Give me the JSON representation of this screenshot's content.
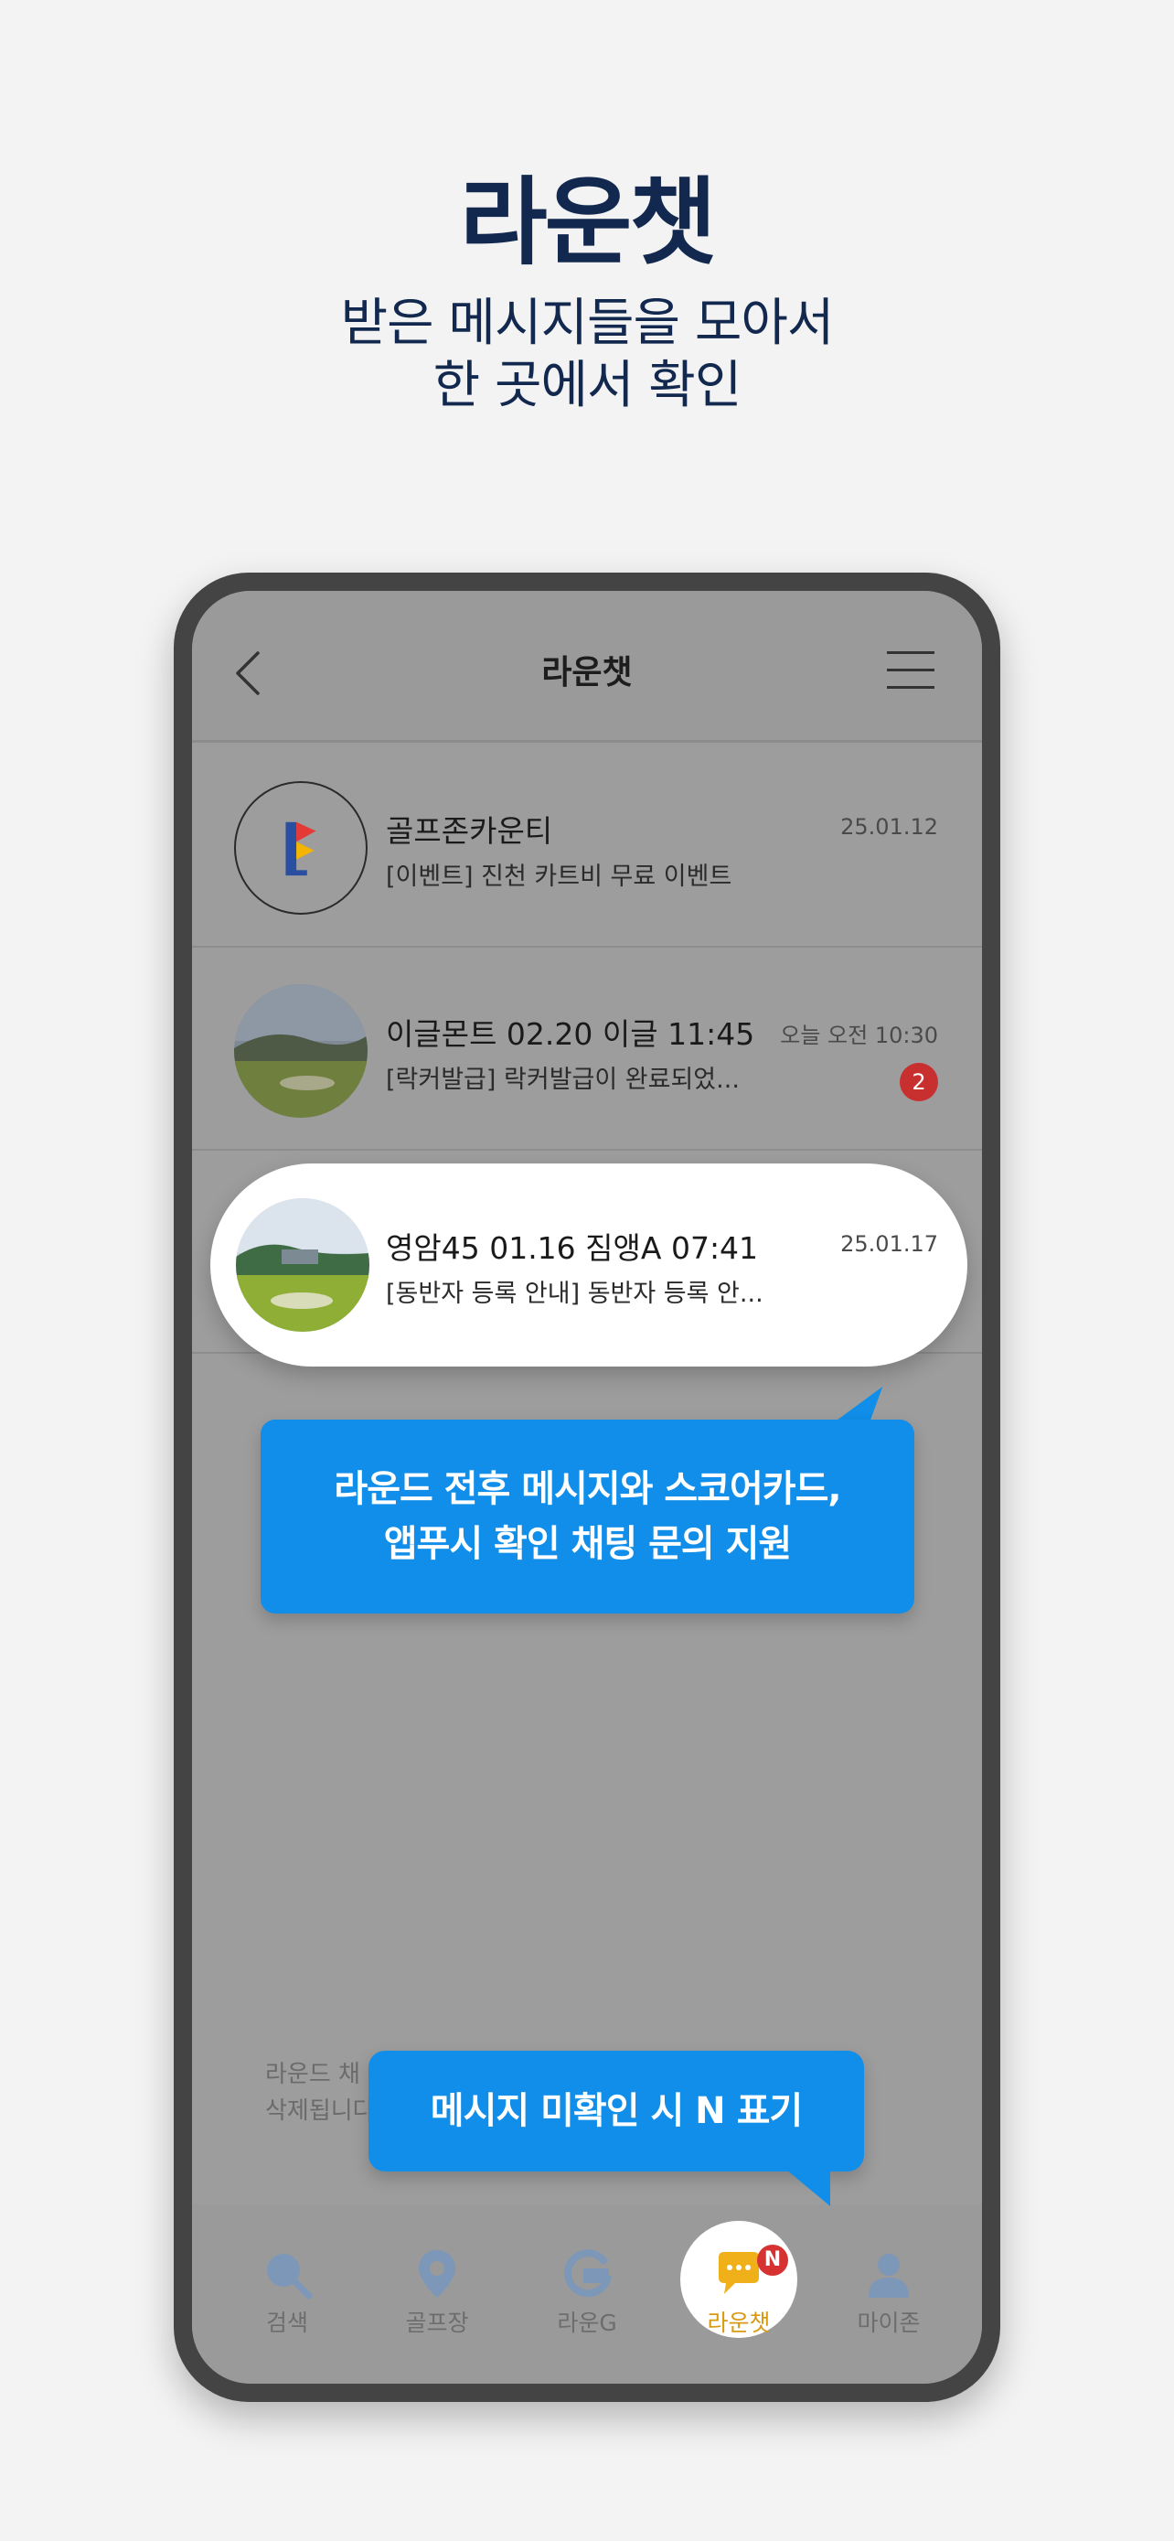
{
  "promo": {
    "title": "라운챗",
    "subtitle_line1": "받은 메시지들을 모아서",
    "subtitle_line2": "한 곳에서 확인"
  },
  "header": {
    "title": "라운챗",
    "back_icon": "chevron-left-icon",
    "menu_icon": "hamburger-menu-icon"
  },
  "chats": [
    {
      "name": "골프존카운티",
      "preview": "[이벤트] 진천 카트비 무료 이벤트",
      "time": "25.01.12",
      "avatar": "golfzon-county-logo"
    },
    {
      "name": "이글몬트 02.20 이글 11:45",
      "preview": "[락커발급] 락커발급이 완료되었...",
      "time": "오늘 오전 10:30",
      "unread": "2",
      "avatar": "golf-course-photo"
    },
    {
      "name": "영암45 01.16 짐앵A 07:41",
      "preview": "[동반자 등록 안내] 동반자 등록 안...",
      "time": "25.01.17",
      "avatar": "golf-course-photo"
    }
  ],
  "footer_note": {
    "line1": "라운드 채",
    "line2": "삭제됩니다"
  },
  "callouts": {
    "chat_support_line1": "라운드 전후 메시지와 스코어카드,",
    "chat_support_line2": "앱푸시 확인 채팅 문의 지원",
    "unread_marker": "메시지 미확인 시 N 표기"
  },
  "nav": {
    "items": [
      {
        "label": "검색",
        "icon": "search-icon"
      },
      {
        "label": "골프장",
        "icon": "map-pin-icon"
      },
      {
        "label": "라운G",
        "icon": "g-logo-icon"
      },
      {
        "label": "라운챗",
        "icon": "chat-bubble-icon",
        "active": true
      },
      {
        "label": "마이존",
        "icon": "user-icon"
      }
    ],
    "new_badge": "N"
  },
  "colors": {
    "brand_navy": "#12284f",
    "callout_blue": "#108ee9",
    "unread_red": "#c8302f",
    "active_yellow": "#f0b019"
  }
}
